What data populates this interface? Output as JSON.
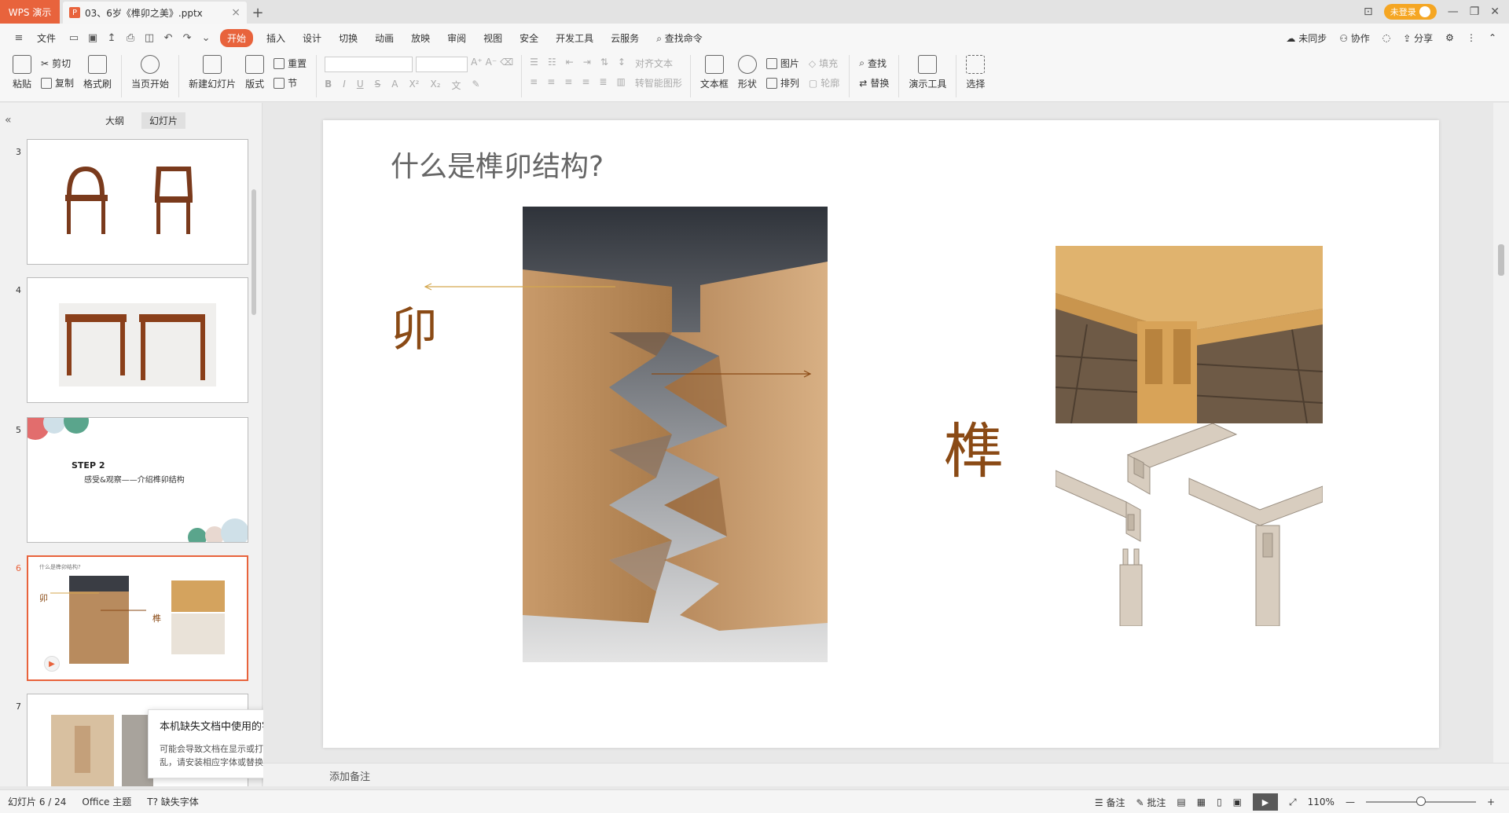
{
  "titlebar": {
    "app_name": "WPS 演示",
    "doc_tab": "03、6岁《榫卯之美》.pptx",
    "login": "未登录"
  },
  "menubar": {
    "file": "文件",
    "tabs": [
      "开始",
      "插入",
      "设计",
      "切换",
      "动画",
      "放映",
      "审阅",
      "视图",
      "安全",
      "开发工具",
      "云服务"
    ],
    "search": "查找命令",
    "right": {
      "sync": "未同步",
      "collab": "协作",
      "share": "分享"
    }
  },
  "ribbon": {
    "paste": "粘贴",
    "cut": "剪切",
    "copy": "复制",
    "format_painter": "格式刷",
    "from_current": "当页开始",
    "new_slide": "新建幻灯片",
    "layout": "版式",
    "reset": "重置",
    "section": "节",
    "align_text": "对齐文本",
    "convert_smartart": "转智能图形",
    "textbox": "文本框",
    "shape": "形状",
    "picture": "图片",
    "arrange": "排列",
    "fill": "填充",
    "outline": "轮廓",
    "find": "查找",
    "replace": "替换",
    "present_tools": "演示工具",
    "select": "选择"
  },
  "leftpane": {
    "tab_outline": "大纲",
    "tab_slides": "幻灯片",
    "slides": [
      {
        "num": "3"
      },
      {
        "num": "4"
      },
      {
        "num": "5",
        "text_title": "STEP 2",
        "text_sub": "感受&观察——介绍榫卯结构"
      },
      {
        "num": "6",
        "text_title": "什么是榫卯结构?",
        "label_luan": "卯",
        "label_sun": "榫"
      },
      {
        "num": "7"
      }
    ]
  },
  "slide": {
    "title": "什么是榫卯结构?",
    "label_luan": "卯",
    "label_sun": "榫"
  },
  "notes": {
    "placeholder": "添加备注"
  },
  "popup": {
    "title": "本机缺失文档中使用的字体",
    "body": "可能会导致文档在显示或打印时显示错乱，请安装相应字体或替换为其他字体"
  },
  "statusbar": {
    "slide_counter": "幻灯片 6 / 24",
    "theme": "Office 主题",
    "missing_font": "缺失字体",
    "notes": "备注",
    "comments": "批注",
    "zoom": "110%"
  },
  "colors": {
    "accent": "#e8633c",
    "label_brown": "#8a4a15"
  }
}
